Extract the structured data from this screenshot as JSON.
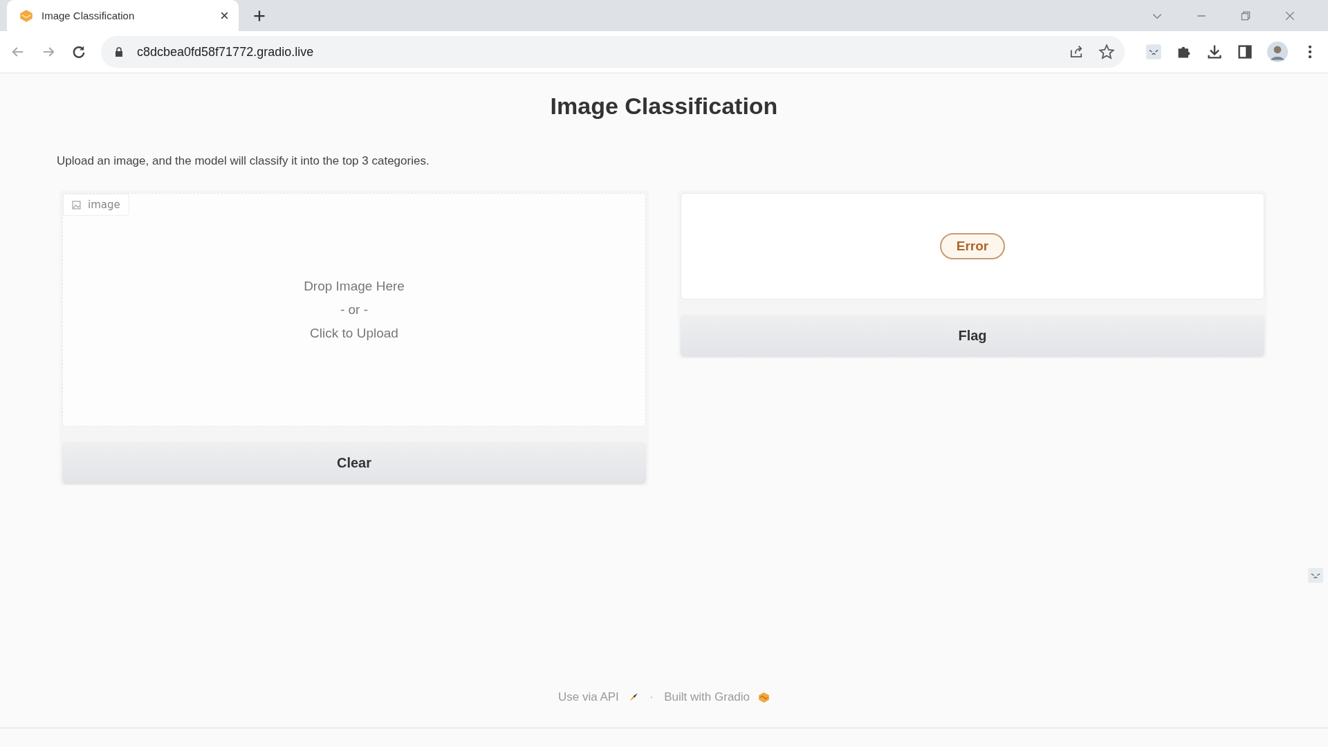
{
  "browser": {
    "tab": {
      "title": "Image Classification",
      "selected": true
    },
    "url": "c8dcbea0fd58f71772.gradio.live"
  },
  "page": {
    "title": "Image Classification",
    "description": "Upload an image, and the model will classify it into the top 3 categories."
  },
  "input": {
    "label": "image",
    "drop_lines": [
      "Drop Image Here",
      "- or -",
      "Click to Upload"
    ],
    "button": "Clear"
  },
  "output": {
    "status": "Error",
    "button": "Flag"
  },
  "footer": {
    "api_link": "Use via API",
    "separator": "·",
    "built_with": "Built with Gradio"
  }
}
